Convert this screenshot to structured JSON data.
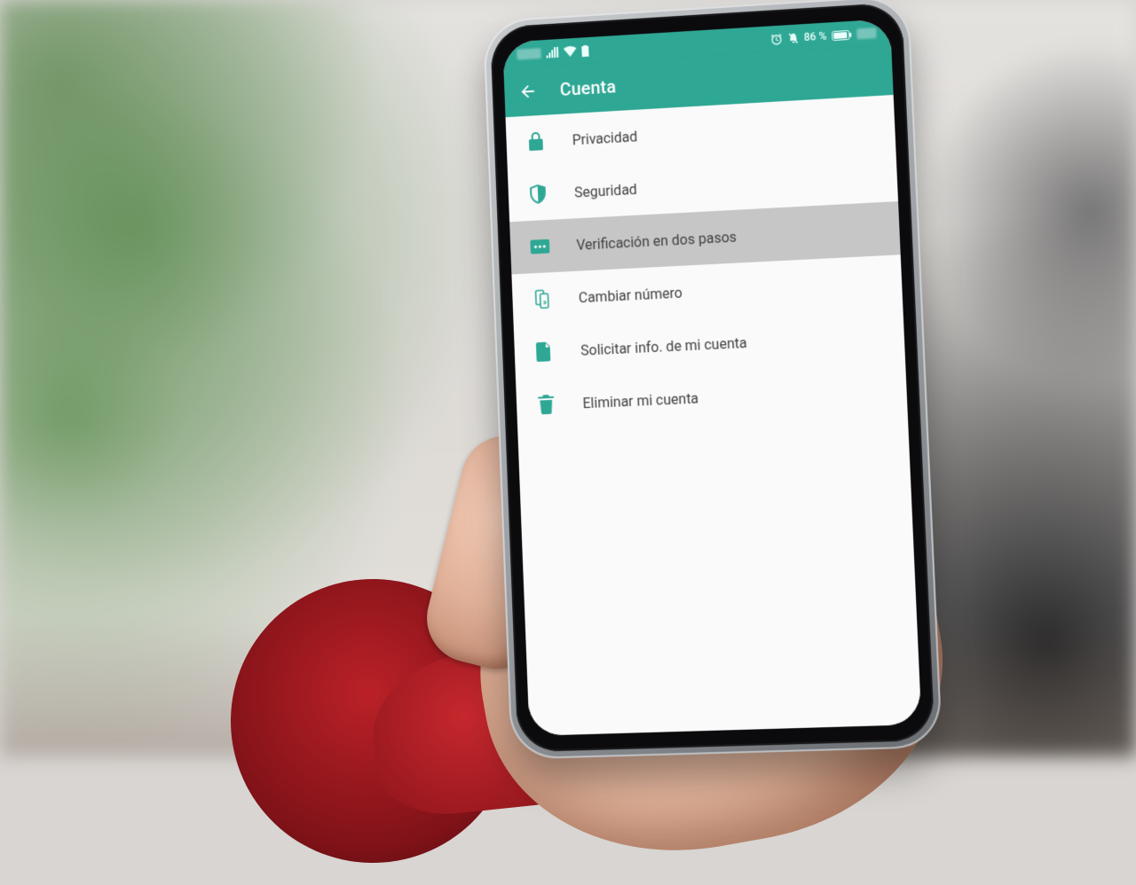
{
  "status_bar": {
    "battery_label": "86 %"
  },
  "app_bar": {
    "title": "Cuenta"
  },
  "menu": {
    "items": [
      {
        "label": "Privacidad"
      },
      {
        "label": "Seguridad"
      },
      {
        "label": "Verificación en dos pasos"
      },
      {
        "label": "Cambiar número"
      },
      {
        "label": "Solicitar info. de mi cuenta"
      },
      {
        "label": "Eliminar mi cuenta"
      }
    ],
    "pressed_index": 2
  },
  "colors": {
    "accent_teal": "#2fa795"
  }
}
